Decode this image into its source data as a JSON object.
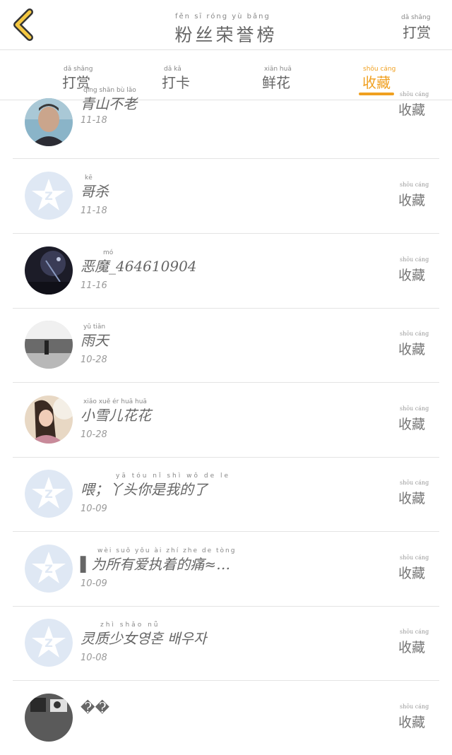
{
  "header": {
    "title": "粉丝荣誉榜",
    "title_pinyin": "fěn   sī   róng   yù   bǎng",
    "action_label": "打赏",
    "action_pinyin": "dǎ shǎng"
  },
  "tabs": [
    {
      "label": "打赏",
      "pinyin": "dǎ shǎng",
      "active": false
    },
    {
      "label": "打卡",
      "pinyin": "dǎ  kǎ",
      "active": false
    },
    {
      "label": "鲜花",
      "pinyin": "xiān huā",
      "active": false
    },
    {
      "label": "收藏",
      "pinyin": "shōu cáng",
      "active": true
    }
  ],
  "accent_color": "#f0a020",
  "fav_label": "收藏",
  "fav_pinyin": "shōu cáng",
  "rows": [
    {
      "name": "青山不老",
      "pinyin": "qīng shān bù lǎo",
      "date": "11-18",
      "avatar": "photo-man"
    },
    {
      "name": "哥杀",
      "pinyin": "kē",
      "date": "11-18",
      "avatar": "default-qq-icon"
    },
    {
      "name": "恶魔_464610904",
      "pinyin": "mó",
      "date": "11-16",
      "avatar": "photo-dark"
    },
    {
      "name": "雨天",
      "pinyin": "yǔ tiān",
      "date": "10-28",
      "avatar": "photo-gray"
    },
    {
      "name": "小雪儿花花",
      "pinyin": "xiǎo xuě ér huā huā",
      "date": "10-28",
      "avatar": "photo-girl"
    },
    {
      "name": "喂；丫头你是我的了",
      "pinyin": "yā tóu nǐ shì wǒ de le",
      "date": "10-09",
      "avatar": "default-qq-icon"
    },
    {
      "name": "▌为所有爱执着的痛≈…",
      "pinyin": "wèi suǒ yǒu ài zhí zhe de tòng",
      "date": "10-09",
      "avatar": "default-qq-icon"
    },
    {
      "name": "灵质少女영혼 배우자",
      "pinyin": "zhì shǎo nǚ",
      "date": "10-08",
      "avatar": "default-qq-icon"
    },
    {
      "name": "��",
      "pinyin": "",
      "date": "",
      "avatar": "photo-bw"
    }
  ]
}
